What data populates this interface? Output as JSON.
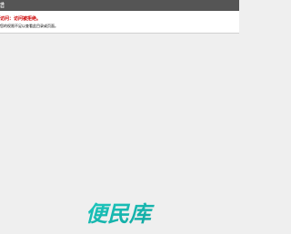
{
  "window": {
    "title": "错"
  },
  "error": {
    "heading": "访问：访问被拒绝。",
    "detail": "您的权限不足以查看此目录或页面。"
  },
  "watermark": {
    "brand_text": "便民库",
    "accent_color": "#16b7b0"
  },
  "colors": {
    "titlebar_bg": "#555555",
    "panel_bg": "#ffffff",
    "page_bg": "#efefef",
    "error_red": "#cc0000"
  }
}
